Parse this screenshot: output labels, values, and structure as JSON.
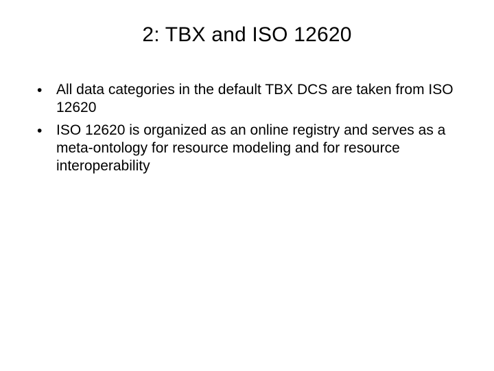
{
  "title": "2: TBX and ISO 12620",
  "bullets": [
    "All data categories in the default TBX DCS are taken from ISO 12620",
    "ISO 12620 is organized as an online registry and serves as a meta-ontology for resource modeling and for resource interoperability"
  ]
}
